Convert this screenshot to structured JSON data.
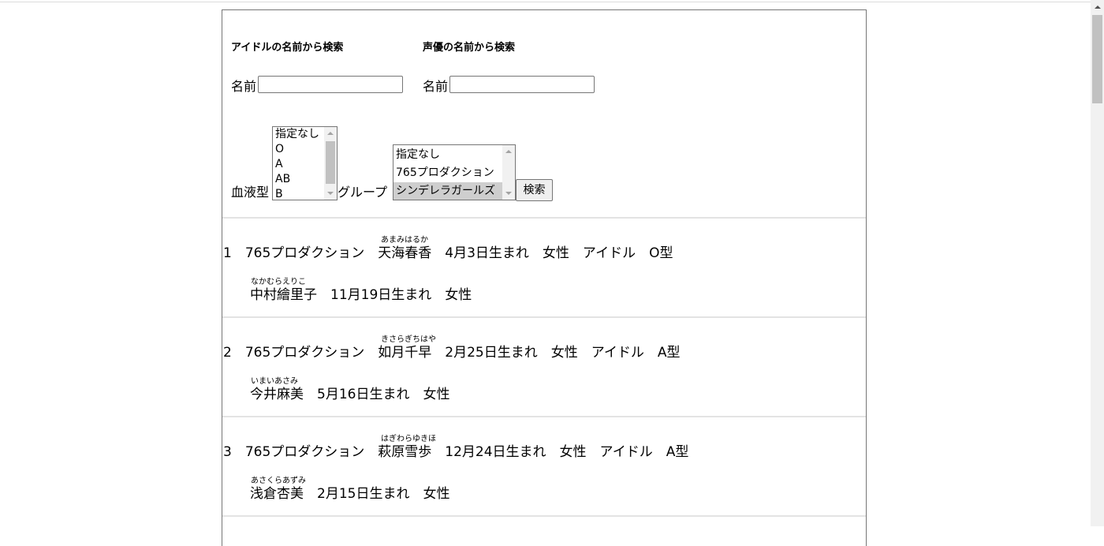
{
  "search": {
    "idol_heading": "アイドルの名前から検索",
    "seiyu_heading": "声優の名前から検索",
    "idol_name_label": "名前",
    "seiyu_name_label": "名前",
    "idol_name_value": "",
    "seiyu_name_value": "",
    "blood_label": "血液型",
    "blood_options": [
      "指定なし",
      "O",
      "A",
      "AB",
      "B"
    ],
    "group_label": "グループ",
    "group_options": [
      "指定なし",
      "765プロダクション",
      "シンデレラガールズ"
    ],
    "group_selected": "シンデレラガールズ",
    "submit_label": "検索"
  },
  "results": [
    {
      "index": "1",
      "group": "765プロダクション",
      "idol_name": "天海春香",
      "idol_ruby": "あまみはるか",
      "birthday": "4月3日生まれ",
      "gender": "女性",
      "role": "アイドル",
      "blood": "O型",
      "seiyu_name": "中村繪里子",
      "seiyu_ruby": "なかむらえりこ",
      "seiyu_birthday": "11月19日生まれ",
      "seiyu_gender": "女性"
    },
    {
      "index": "2",
      "group": "765プロダクション",
      "idol_name": "如月千早",
      "idol_ruby": "きさらぎちはや",
      "birthday": "2月25日生まれ",
      "gender": "女性",
      "role": "アイドル",
      "blood": "A型",
      "seiyu_name": "今井麻美",
      "seiyu_ruby": "いまいあさみ",
      "seiyu_birthday": "5月16日生まれ",
      "seiyu_gender": "女性"
    },
    {
      "index": "3",
      "group": "765プロダクション",
      "idol_name": "萩原雪歩",
      "idol_ruby": "はぎわらゆきほ",
      "birthday": "12月24日生まれ",
      "gender": "女性",
      "role": "アイドル",
      "blood": "A型",
      "seiyu_name": "浅倉杏美",
      "seiyu_ruby": "あさくらあずみ",
      "seiyu_birthday": "2月15日生まれ",
      "seiyu_gender": "女性"
    }
  ]
}
